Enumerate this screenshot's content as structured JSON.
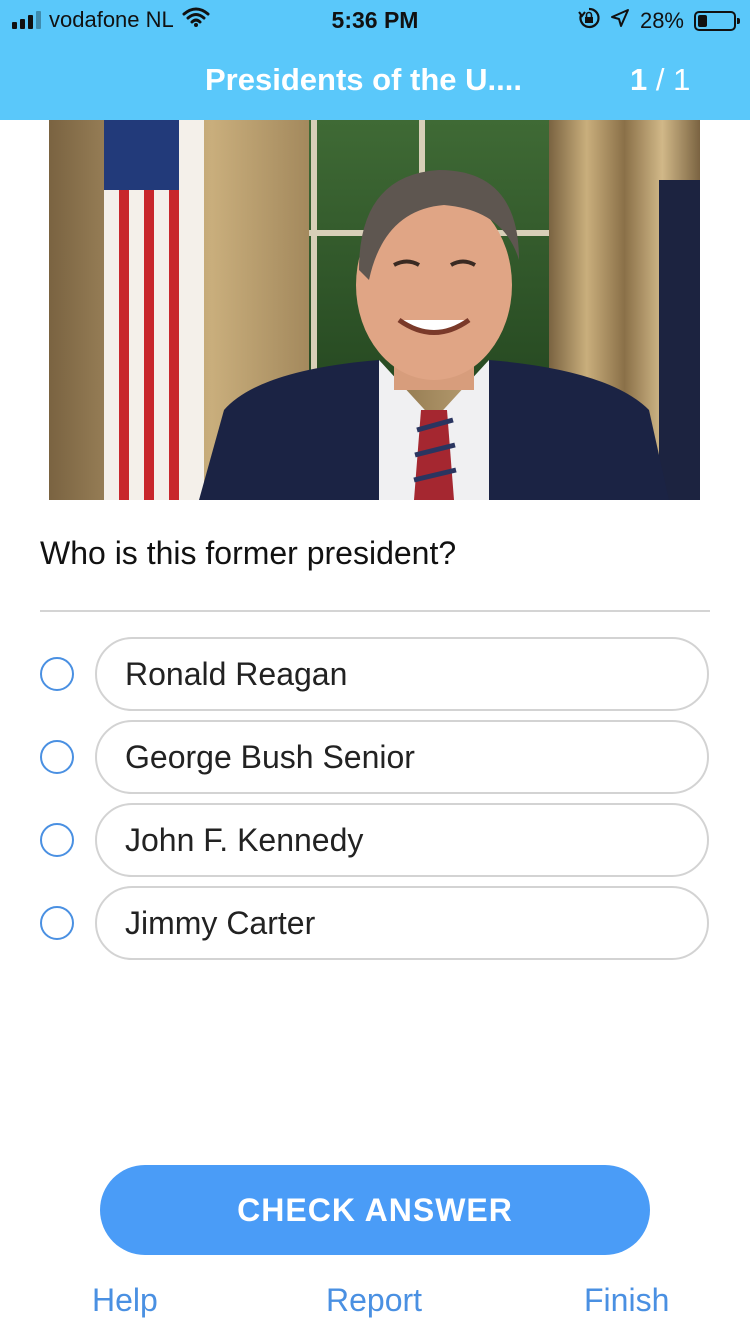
{
  "status_bar": {
    "carrier": "vodafone NL",
    "time": "5:36 PM",
    "battery_percent": "28%",
    "icons": [
      "signal-icon",
      "wifi-icon",
      "rotation-lock-icon",
      "location-arrow-icon",
      "battery-icon"
    ]
  },
  "header": {
    "title": "Presidents of the U....",
    "counter_current": "1",
    "counter_sep": " / ",
    "counter_total": "1",
    "background_color": "#5ac8fa"
  },
  "question": {
    "text": "Who is this former president?"
  },
  "options": [
    {
      "label": "Ronald Reagan",
      "selected": false
    },
    {
      "label": "George Bush Senior",
      "selected": false
    },
    {
      "label": "John F. Kennedy",
      "selected": false
    },
    {
      "label": "Jimmy Carter",
      "selected": false
    }
  ],
  "actions": {
    "check_label": "CHECK ANSWER",
    "check_color": "#4a9cf7"
  },
  "footer": {
    "help": "Help",
    "report": "Report",
    "finish": "Finish",
    "link_color": "#4a90e2"
  }
}
